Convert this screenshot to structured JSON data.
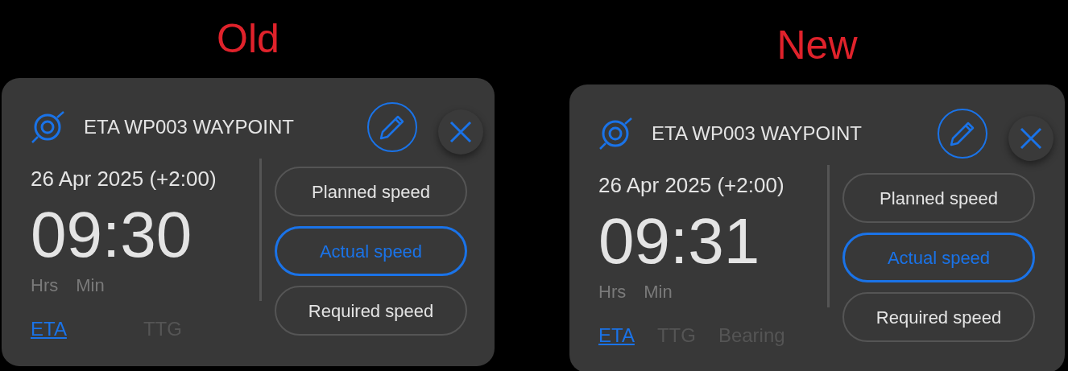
{
  "panels": [
    {
      "heading": "Old",
      "title": "ETA WP003 WAYPOINT",
      "date": "26 Apr 2025 (+2:00)",
      "time": "09:30",
      "units": [
        "Hrs",
        "Min"
      ],
      "speed_buttons": [
        {
          "label": "Planned speed",
          "selected": false
        },
        {
          "label": "Actual speed",
          "selected": true
        },
        {
          "label": "Required speed",
          "selected": false
        }
      ],
      "tabs": [
        {
          "label": "ETA",
          "selected": true
        },
        {
          "label": "TTG",
          "selected": false
        }
      ]
    },
    {
      "heading": "New",
      "title": "ETA WP003 WAYPOINT",
      "date": "26 Apr 2025 (+2:00)",
      "time": "09:31",
      "units": [
        "Hrs",
        "Min"
      ],
      "speed_buttons": [
        {
          "label": "Planned speed",
          "selected": false
        },
        {
          "label": "Actual speed",
          "selected": true
        },
        {
          "label": "Required speed",
          "selected": false
        }
      ],
      "tabs": [
        {
          "label": "ETA",
          "selected": true
        },
        {
          "label": "TTG",
          "selected": false
        },
        {
          "label": "Bearing",
          "selected": false
        }
      ]
    }
  ]
}
